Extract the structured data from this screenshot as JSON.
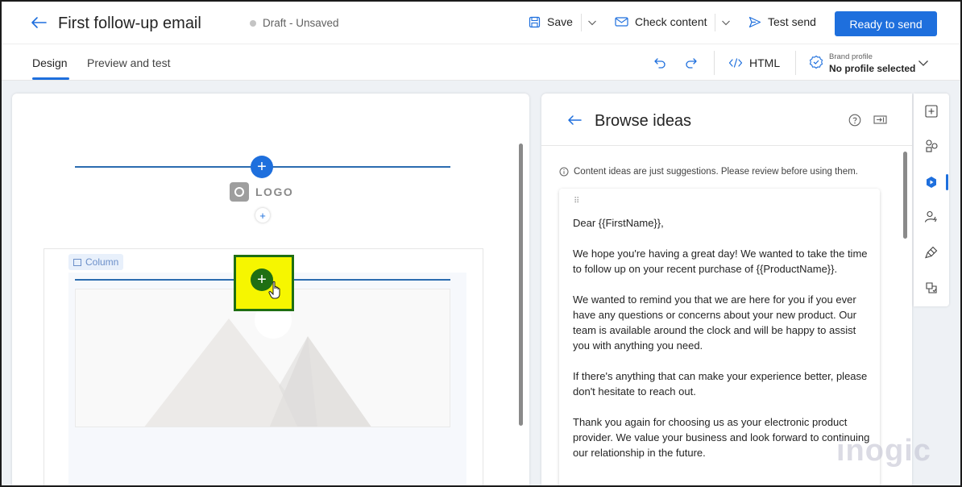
{
  "header": {
    "title": "First follow-up email",
    "status": "Draft - Unsaved",
    "save_label": "Save",
    "check_content_label": "Check content",
    "test_send_label": "Test send",
    "ready_label": "Ready to send"
  },
  "tabs": {
    "design": "Design",
    "preview": "Preview and test",
    "html_label": "HTML",
    "brand_profile_label": "Brand profile",
    "brand_profile_value": "No profile selected"
  },
  "canvas": {
    "logo_text": "LOGO",
    "column_label": "Column"
  },
  "ideas": {
    "title": "Browse ideas",
    "notice": "Content ideas are just suggestions. Please review before using them.",
    "paragraphs": [
      "Dear {{FirstName}},",
      "We hope you're having a great day! We wanted to take the time to follow up on your recent purchase of {{ProductName}}.",
      "We wanted to remind you that we are here for you if you ever have any questions or concerns about your new product. Our team is available around the clock and will be happy to assist you with anything you need.",
      "If there's anything that can make your experience better, please don't hesitate to reach out.",
      "Thank you again for choosing us as your electronic product provider. We value your business and look forward to continuing our relationship in the future."
    ]
  },
  "watermark": "inogic",
  "colors": {
    "accent": "#1e6fdd",
    "highlight": "#f6f600",
    "highlight_border": "#1f6f13"
  }
}
